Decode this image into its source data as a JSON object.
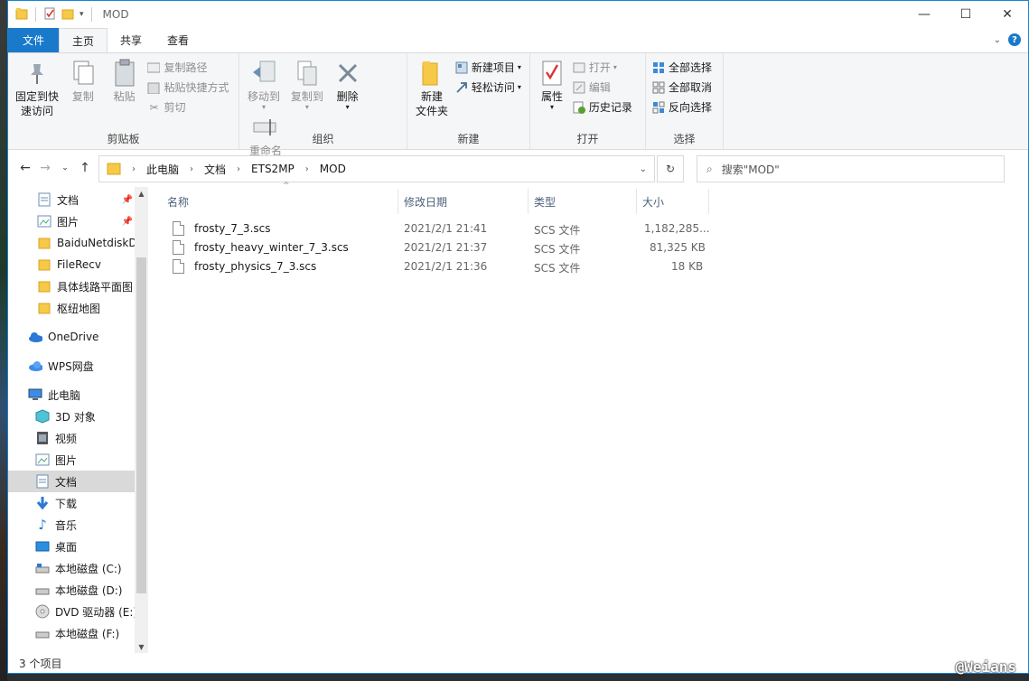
{
  "window": {
    "title": "MOD"
  },
  "controls": {
    "minimize": "—",
    "maximize": "☐",
    "close": "✕"
  },
  "ribbon_tabs": [
    {
      "label": "文件"
    },
    {
      "label": "主页"
    },
    {
      "label": "共享"
    },
    {
      "label": "查看"
    }
  ],
  "ribbon": {
    "clipboard": {
      "label": "剪贴板",
      "pin": "固定到快\n速访问",
      "pin_l1": "固定到快",
      "pin_l2": "速访问",
      "copy": "复制",
      "paste": "粘贴",
      "copy_path": "复制路径",
      "paste_shortcut": "粘贴快捷方式",
      "cut": "剪切"
    },
    "organize": {
      "label": "组织",
      "move_to": "移动到",
      "copy_to": "复制到",
      "delete": "删除",
      "rename": "重命名"
    },
    "new": {
      "label": "新建",
      "new_folder_l1": "新建",
      "new_folder_l2": "文件夹",
      "new_item": "新建项目",
      "easy_access": "轻松访问"
    },
    "open": {
      "label": "打开",
      "properties": "属性",
      "open": "打开",
      "edit": "编辑",
      "history": "历史记录"
    },
    "select": {
      "label": "选择",
      "select_all": "全部选择",
      "select_none": "全部取消",
      "invert": "反向选择"
    }
  },
  "address": {
    "crumbs": [
      "此电脑",
      "文档",
      "ETS2MP",
      "MOD"
    ],
    "search_placeholder": "搜索\"MOD\""
  },
  "nav": [
    {
      "label": "文档",
      "icon": "document-icon",
      "pinned": true
    },
    {
      "label": "图片",
      "icon": "picture-icon",
      "pinned": true
    },
    {
      "label": "BaiduNetdiskD",
      "icon": "folder-icon"
    },
    {
      "label": "FileRecv",
      "icon": "folder-icon"
    },
    {
      "label": "具体线路平面图",
      "icon": "folder-icon"
    },
    {
      "label": "枢纽地图",
      "icon": "folder-icon"
    },
    {
      "label": "OneDrive",
      "icon": "cloud-icon"
    },
    {
      "label": "WPS网盘",
      "icon": "cloud-icon"
    },
    {
      "label": "此电脑",
      "icon": "computer-icon"
    },
    {
      "label": "3D 对象",
      "icon": "cube-icon"
    },
    {
      "label": "视频",
      "icon": "video-icon"
    },
    {
      "label": "图片",
      "icon": "picture-icon"
    },
    {
      "label": "文档",
      "icon": "document-icon",
      "selected": true
    },
    {
      "label": "下载",
      "icon": "download-icon"
    },
    {
      "label": "音乐",
      "icon": "music-icon"
    },
    {
      "label": "桌面",
      "icon": "desktop-icon"
    },
    {
      "label": "本地磁盘 (C:)",
      "icon": "drive-icon"
    },
    {
      "label": "本地磁盘 (D:)",
      "icon": "drive-icon"
    },
    {
      "label": "DVD 驱动器 (E:)",
      "icon": "dvd-icon"
    },
    {
      "label": "本地磁盘 (F:)",
      "icon": "drive-icon"
    }
  ],
  "columns": {
    "name": "名称",
    "modified": "修改日期",
    "type": "类型",
    "size": "大小"
  },
  "files": [
    {
      "name": "frosty_7_3.scs",
      "modified": "2021/2/1 21:41",
      "type": "SCS 文件",
      "size": "1,182,285..."
    },
    {
      "name": "frosty_heavy_winter_7_3.scs",
      "modified": "2021/2/1 21:37",
      "type": "SCS 文件",
      "size": "81,325 KB"
    },
    {
      "name": "frosty_physics_7_3.scs",
      "modified": "2021/2/1 21:36",
      "type": "SCS 文件",
      "size": "18 KB"
    }
  ],
  "status": {
    "count": "3 个项目"
  },
  "watermark": "@Weians",
  "colors": {
    "accent": "#1979ca",
    "selection": "#d9d9d9",
    "folder": "#f7c948"
  }
}
